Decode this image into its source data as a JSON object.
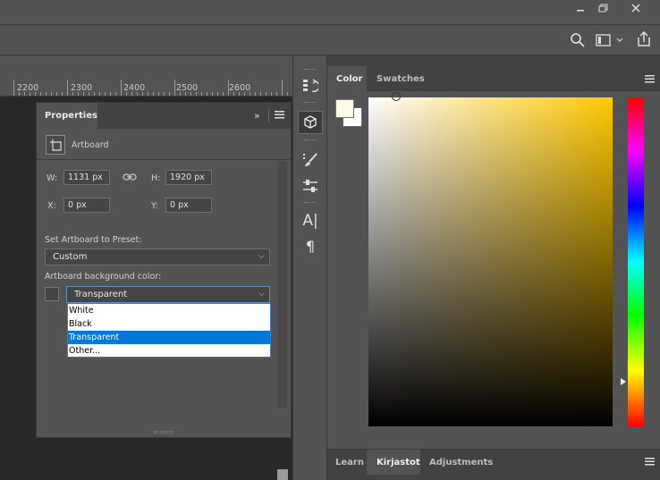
{
  "window": {
    "controls": {
      "minimize_icon": "minimize-icon",
      "restore_icon": "restore-icon",
      "close_icon": "close-icon"
    }
  },
  "toolbar_top": {
    "icons": [
      "search-icon",
      "workspace-icon",
      "share-icon"
    ]
  },
  "ruler": {
    "labels": [
      "2200",
      "2300",
      "2400",
      "2500",
      "2600"
    ]
  },
  "properties": {
    "tab_label": "Properties",
    "section_label": "Artboard",
    "w_label": "W:",
    "w_value": "1131 px",
    "h_label": "H:",
    "h_value": "1920 px",
    "x_label": "X:",
    "x_value": "0 px",
    "y_label": "Y:",
    "y_value": "0 px",
    "preset_label": "Set Artboard to Preset:",
    "preset_value": "Custom",
    "bg_label": "Artboard background color:",
    "bg_value": "Transparent",
    "bg_options": [
      "White",
      "Black",
      "Transparent",
      "Other..."
    ],
    "bg_selected_index": 2
  },
  "color_panel": {
    "tabs": [
      "Color",
      "Swatches"
    ],
    "active_tab": "Color",
    "foreground_color": "#fffbe6",
    "background_color": "#ffffff",
    "hue_color": "#ffc800"
  },
  "bottom_panel": {
    "tabs": [
      "Learn",
      "Kirjastot",
      "Adjustments"
    ],
    "active_tab": "Kirjastot"
  },
  "colors": {
    "ui_bg": "#535353",
    "panel_header": "#424242",
    "canvas": "#282828",
    "select_highlight": "#0078d7"
  }
}
